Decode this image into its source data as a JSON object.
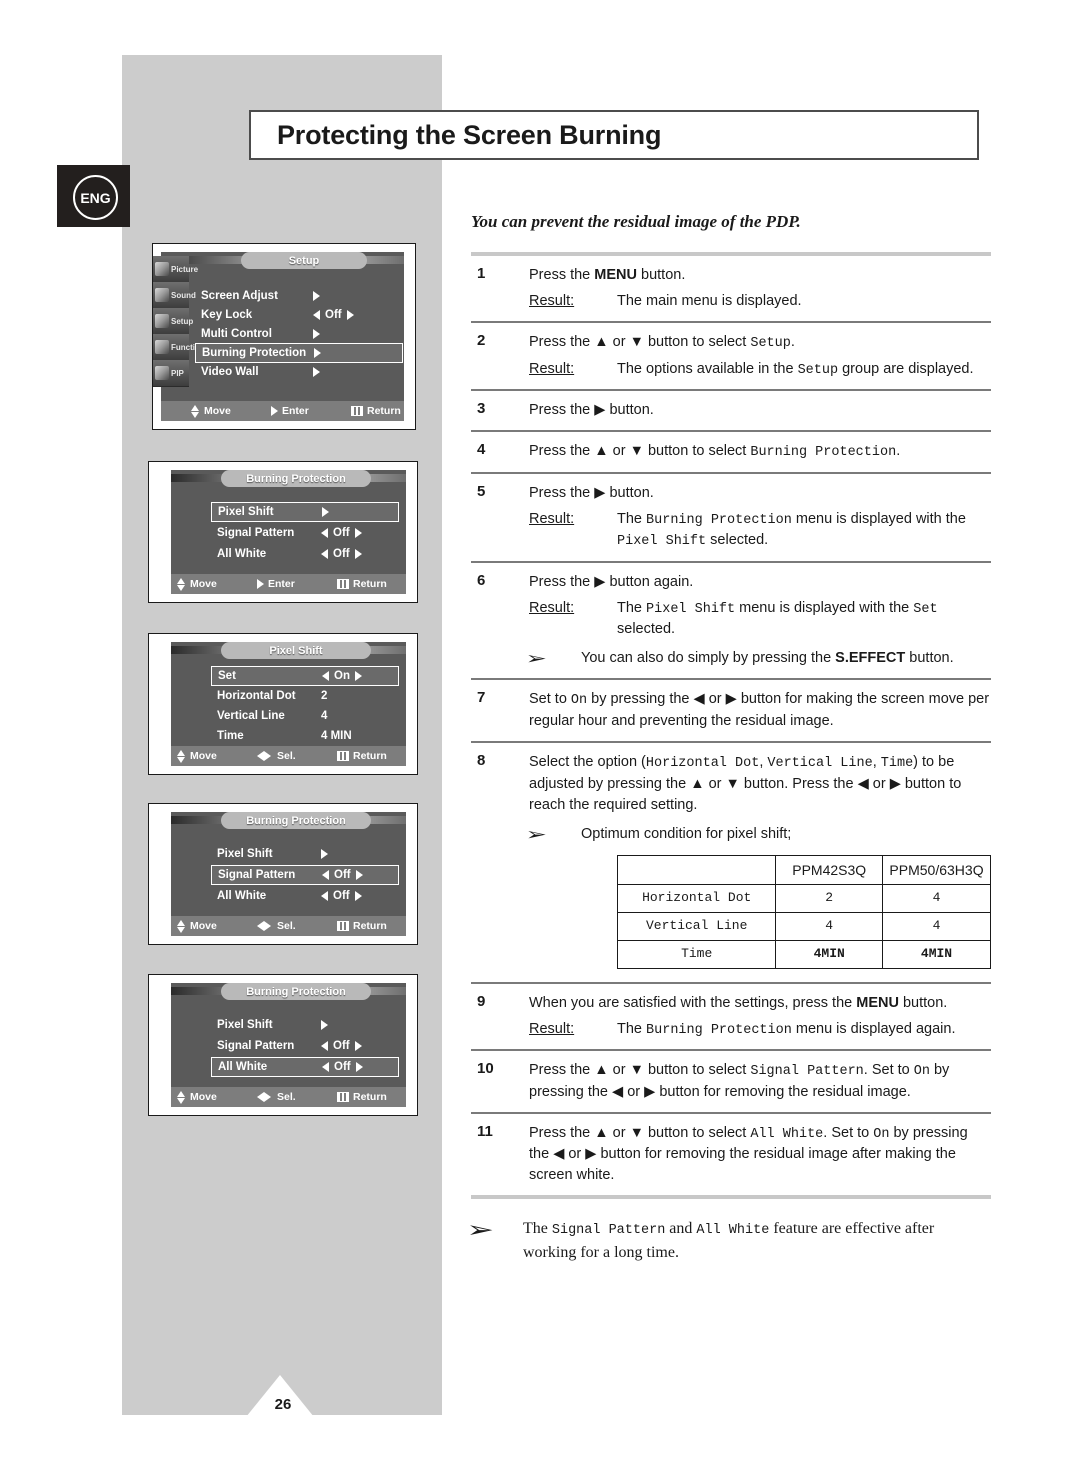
{
  "page": {
    "number": "26",
    "language_badge": "ENG",
    "title": "Protecting the Screen Burning",
    "intro": "You can prevent the residual image of the PDP."
  },
  "steps": [
    {
      "num": "1",
      "text_parts": [
        {
          "t": "Press the ",
          "s": "n"
        },
        {
          "t": "MENU",
          "s": "b"
        },
        {
          "t": " button.",
          "s": "n"
        }
      ],
      "result_label": "Result:",
      "result_parts": [
        {
          "t": "The main menu is displayed.",
          "s": "n"
        }
      ]
    },
    {
      "num": "2",
      "text_parts": [
        {
          "t": "Press the ",
          "s": "n"
        },
        {
          "t": "▲",
          "s": "n"
        },
        {
          "t": " or ",
          "s": "n"
        },
        {
          "t": "▼",
          "s": "n"
        },
        {
          "t": " button to select ",
          "s": "n"
        },
        {
          "t": "Setup",
          "s": "m"
        },
        {
          "t": ".",
          "s": "n"
        }
      ],
      "result_label": "Result:",
      "result_parts": [
        {
          "t": "The options available in the ",
          "s": "n"
        },
        {
          "t": "Setup",
          "s": "m"
        },
        {
          "t": " group are displayed.",
          "s": "n"
        }
      ]
    },
    {
      "num": "3",
      "text_parts": [
        {
          "t": "Press the ",
          "s": "n"
        },
        {
          "t": "▶",
          "s": "n"
        },
        {
          "t": " button.",
          "s": "n"
        }
      ]
    },
    {
      "num": "4",
      "text_parts": [
        {
          "t": "Press the ",
          "s": "n"
        },
        {
          "t": "▲",
          "s": "n"
        },
        {
          "t": " or ",
          "s": "n"
        },
        {
          "t": "▼",
          "s": "n"
        },
        {
          "t": " button to select ",
          "s": "n"
        },
        {
          "t": "Burning Protection",
          "s": "m"
        },
        {
          "t": ".",
          "s": "n"
        }
      ]
    },
    {
      "num": "5",
      "text_parts": [
        {
          "t": "Press the ",
          "s": "n"
        },
        {
          "t": "▶",
          "s": "n"
        },
        {
          "t": " button.",
          "s": "n"
        }
      ],
      "result_label": "Result:",
      "result_parts": [
        {
          "t": "The ",
          "s": "n"
        },
        {
          "t": "Burning Protection",
          "s": "m"
        },
        {
          "t": " menu is displayed with the ",
          "s": "n"
        },
        {
          "t": "Pixel Shift",
          "s": "m"
        },
        {
          "t": " selected.",
          "s": "n"
        }
      ]
    },
    {
      "num": "6",
      "text_parts": [
        {
          "t": "Press the ",
          "s": "n"
        },
        {
          "t": "▶",
          "s": "n"
        },
        {
          "t": " button again.",
          "s": "n"
        }
      ],
      "result_label": "Result:",
      "result_parts": [
        {
          "t": "The ",
          "s": "n"
        },
        {
          "t": "Pixel Shift",
          "s": "m"
        },
        {
          "t": " menu is displayed with the ",
          "s": "n"
        },
        {
          "t": "Set",
          "s": "m"
        },
        {
          "t": " selected.",
          "s": "n"
        }
      ],
      "note_parts": [
        {
          "t": "You can also do simply by pressing the ",
          "s": "n"
        },
        {
          "t": "S.EFFECT",
          "s": "b"
        },
        {
          "t": " button.",
          "s": "n"
        }
      ]
    },
    {
      "num": "7",
      "text_parts": [
        {
          "t": "Set to ",
          "s": "n"
        },
        {
          "t": "On",
          "s": "m"
        },
        {
          "t": " by pressing the ",
          "s": "n"
        },
        {
          "t": "◀",
          "s": "n"
        },
        {
          "t": " or ",
          "s": "n"
        },
        {
          "t": "▶",
          "s": "n"
        },
        {
          "t": " button for making the screen move per regular hour and preventing the residual image.",
          "s": "n"
        }
      ]
    },
    {
      "num": "8",
      "text_parts": [
        {
          "t": "Select the option (",
          "s": "n"
        },
        {
          "t": "Horizontal Dot",
          "s": "m"
        },
        {
          "t": ", ",
          "s": "n"
        },
        {
          "t": "Vertical Line",
          "s": "m"
        },
        {
          "t": ", ",
          "s": "n"
        },
        {
          "t": "Time",
          "s": "m"
        },
        {
          "t": ") to be adjusted by pressing the ",
          "s": "n"
        },
        {
          "t": "▲",
          "s": "n"
        },
        {
          "t": " or ",
          "s": "n"
        },
        {
          "t": "▼",
          "s": "n"
        },
        {
          "t": " button. Press the ",
          "s": "n"
        },
        {
          "t": "◀",
          "s": "n"
        },
        {
          "t": " or ",
          "s": "n"
        },
        {
          "t": "▶",
          "s": "n"
        },
        {
          "t": " button to reach the required setting.",
          "s": "n"
        }
      ],
      "note_parts": [
        {
          "t": "Optimum condition for pixel shift;",
          "s": "n"
        }
      ],
      "has_table": true
    },
    {
      "num": "9",
      "text_parts": [
        {
          "t": "When you are satisfied with the settings, press the ",
          "s": "n"
        },
        {
          "t": "MENU",
          "s": "b"
        },
        {
          "t": " button.",
          "s": "n"
        }
      ],
      "result_label": "Result:",
      "result_parts": [
        {
          "t": "The ",
          "s": "n"
        },
        {
          "t": "Burning Protection",
          "s": "m"
        },
        {
          "t": " menu is displayed again.",
          "s": "n"
        }
      ]
    },
    {
      "num": "10",
      "text_parts": [
        {
          "t": "Press the ",
          "s": "n"
        },
        {
          "t": "▲",
          "s": "n"
        },
        {
          "t": " or ",
          "s": "n"
        },
        {
          "t": "▼",
          "s": "n"
        },
        {
          "t": " button to select ",
          "s": "n"
        },
        {
          "t": "Signal Pattern",
          "s": "m"
        },
        {
          "t": ". Set to ",
          "s": "n"
        },
        {
          "t": "On",
          "s": "m"
        },
        {
          "t": " by pressing the ",
          "s": "n"
        },
        {
          "t": "◀",
          "s": "n"
        },
        {
          "t": " or ",
          "s": "n"
        },
        {
          "t": "▶",
          "s": "n"
        },
        {
          "t": " button for removing the residual image.",
          "s": "n"
        }
      ]
    },
    {
      "num": "11",
      "text_parts": [
        {
          "t": "Press the ",
          "s": "n"
        },
        {
          "t": "▲",
          "s": "n"
        },
        {
          "t": " or ",
          "s": "n"
        },
        {
          "t": "▼",
          "s": "n"
        },
        {
          "t": " button to select ",
          "s": "n"
        },
        {
          "t": "All White",
          "s": "m"
        },
        {
          "t": ". Set to ",
          "s": "n"
        },
        {
          "t": "On",
          "s": "m"
        },
        {
          "t": " by pressing the ",
          "s": "n"
        },
        {
          "t": "◀",
          "s": "n"
        },
        {
          "t": " or ",
          "s": "n"
        },
        {
          "t": "▶",
          "s": "n"
        },
        {
          "t": " button for removing the residual image after making the screen white.",
          "s": "n"
        }
      ]
    }
  ],
  "footer_note_parts": [
    {
      "t": "The ",
      "s": "n"
    },
    {
      "t": "Signal Pattern",
      "s": "m"
    },
    {
      "t": " and ",
      "s": "n"
    },
    {
      "t": "All White",
      "s": "m"
    },
    {
      "t": " feature are effective after working for a long time.",
      "s": "n"
    }
  ],
  "spec_table": {
    "headers": [
      "",
      "PPM42S3Q",
      "PPM50/63H3Q"
    ],
    "rows": [
      {
        "label": "Horizontal Dot",
        "values": [
          "2",
          "4"
        ]
      },
      {
        "label": "Vertical Line",
        "values": [
          "4",
          "4"
        ]
      },
      {
        "label": "Time",
        "values": [
          "4MIN",
          "4MIN"
        ]
      }
    ]
  },
  "osd": {
    "setup": {
      "title": "Setup",
      "sidebar": [
        "Picture",
        "Sound",
        "Setup",
        "Function",
        "PIP"
      ],
      "rows": [
        {
          "label": "Screen Adjust",
          "kind": "enter",
          "value": "",
          "selected": false
        },
        {
          "label": "Key Lock",
          "kind": "toggle",
          "value": "Off",
          "selected": false
        },
        {
          "label": "Multi Control",
          "kind": "enter",
          "value": "",
          "selected": false
        },
        {
          "label": "Burning Protection",
          "kind": "enter",
          "value": "",
          "selected": true
        },
        {
          "label": "Video Wall",
          "kind": "enter",
          "value": "",
          "selected": false
        }
      ],
      "footer": [
        "Move",
        "Enter",
        "Return"
      ]
    },
    "burning1": {
      "title": "Burning Protection",
      "rows": [
        {
          "label": "Pixel Shift",
          "kind": "enter",
          "value": "",
          "selected": true
        },
        {
          "label": "Signal Pattern",
          "kind": "toggle",
          "value": "Off",
          "selected": false
        },
        {
          "label": "All White",
          "kind": "toggle",
          "value": "Off",
          "selected": false
        }
      ],
      "footer": [
        "Move",
        "Enter",
        "Return"
      ]
    },
    "pixelshift": {
      "title": "Pixel Shift",
      "rows": [
        {
          "label": "Set",
          "kind": "toggle",
          "value": "On",
          "selected": true
        },
        {
          "label": "Horizontal Dot",
          "kind": "plain",
          "value": "2",
          "selected": false
        },
        {
          "label": "Vertical Line",
          "kind": "plain",
          "value": "4",
          "selected": false
        },
        {
          "label": "Time",
          "kind": "plain",
          "value": "4 MIN",
          "selected": false
        }
      ],
      "footer": [
        "Move",
        "Sel.",
        "Return"
      ]
    },
    "burning2": {
      "title": "Burning Protection",
      "rows": [
        {
          "label": "Pixel Shift",
          "kind": "enter",
          "value": "",
          "selected": false
        },
        {
          "label": "Signal Pattern",
          "kind": "toggle",
          "value": "Off",
          "selected": true
        },
        {
          "label": "All White",
          "kind": "toggle",
          "value": "Off",
          "selected": false
        }
      ],
      "footer": [
        "Move",
        "Sel.",
        "Return"
      ]
    },
    "burning3": {
      "title": "Burning Protection",
      "rows": [
        {
          "label": "Pixel Shift",
          "kind": "enter",
          "value": "",
          "selected": false
        },
        {
          "label": "Signal Pattern",
          "kind": "toggle",
          "value": "Off",
          "selected": false
        },
        {
          "label": "All White",
          "kind": "toggle",
          "value": "Off",
          "selected": true
        }
      ],
      "footer": [
        "Move",
        "Sel.",
        "Return"
      ]
    }
  }
}
